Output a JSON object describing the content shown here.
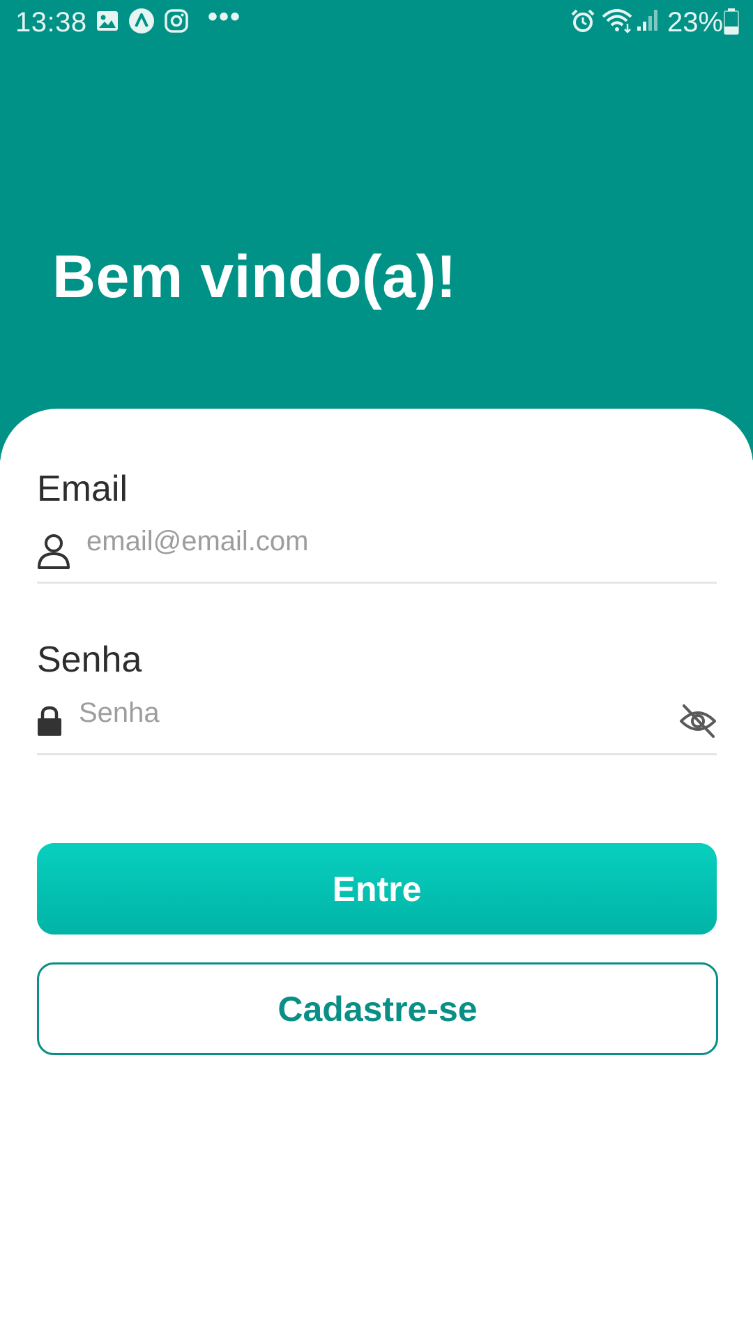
{
  "status_bar": {
    "time": "13:38",
    "notification_icons": [
      "gallery-icon",
      "app-icon",
      "instagram-icon"
    ],
    "overflow": "•••",
    "system_icons": [
      "alarm-icon",
      "wifi-icon",
      "signal-icon"
    ],
    "battery_percent": "23%"
  },
  "header": {
    "title": "Bem vindo(a)!",
    "color": "#009286"
  },
  "form": {
    "email": {
      "label": "Email",
      "placeholder": "email@email.com",
      "icon": "user-icon"
    },
    "password": {
      "label": "Senha",
      "placeholder": "Senha",
      "icon": "lock-icon",
      "toggle_icon": "eye-off-icon"
    }
  },
  "actions": {
    "login_label": "Entre",
    "signup_label": "Cadastre-se",
    "primary_color": "#05c4b4",
    "outline_color": "#0a8f86"
  }
}
